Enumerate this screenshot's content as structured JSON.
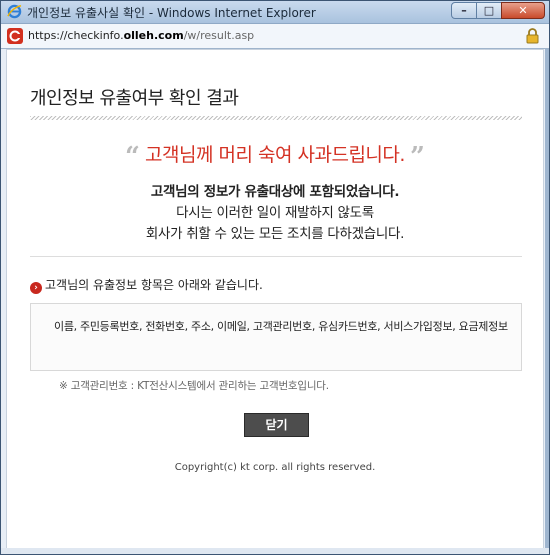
{
  "window": {
    "title": "개인정보 유출사실 확인 - Windows Internet Explorer",
    "buttons": {
      "minimize": "–",
      "maximize": "□",
      "close": "✕"
    }
  },
  "address": {
    "prefix": "https://checkinfo.",
    "domain": "olleh.com",
    "path": "/w/result.asp"
  },
  "page": {
    "title": "개인정보 유출여부 확인 결과",
    "apology": {
      "open_quote": "“",
      "text": "고객님께 머리 숙여 사과드립니다.",
      "close_quote": "”"
    },
    "messages": [
      "고객님의 정보가 유출대상에 포함되었습니다.",
      "다시는 이러한 일이 재발하지 않도록",
      "회사가 취할 수 있는 모든 조치를 다하겠습니다."
    ],
    "section_heading": "고객님의 유출정보 항목은 아래와 같습니다.",
    "leaked_items": "이름, 주민등록번호, 전화번호, 주소, 이메일, 고객관리번호, 유심카드번호, 서비스가입정보, 요금제정보",
    "note": "※ 고객관리번호 : KT전산시스템에서 관리하는 고객번호입니다.",
    "close_button": "닫기",
    "copyright": "Copyright(c) kt corp. all rights reserved."
  },
  "colors": {
    "accent": "#d43224",
    "button_bg": "#4d4d4d"
  },
  "icons": [
    "ie-icon",
    "site-icon",
    "lock-icon",
    "arrow-bullet-icon"
  ]
}
